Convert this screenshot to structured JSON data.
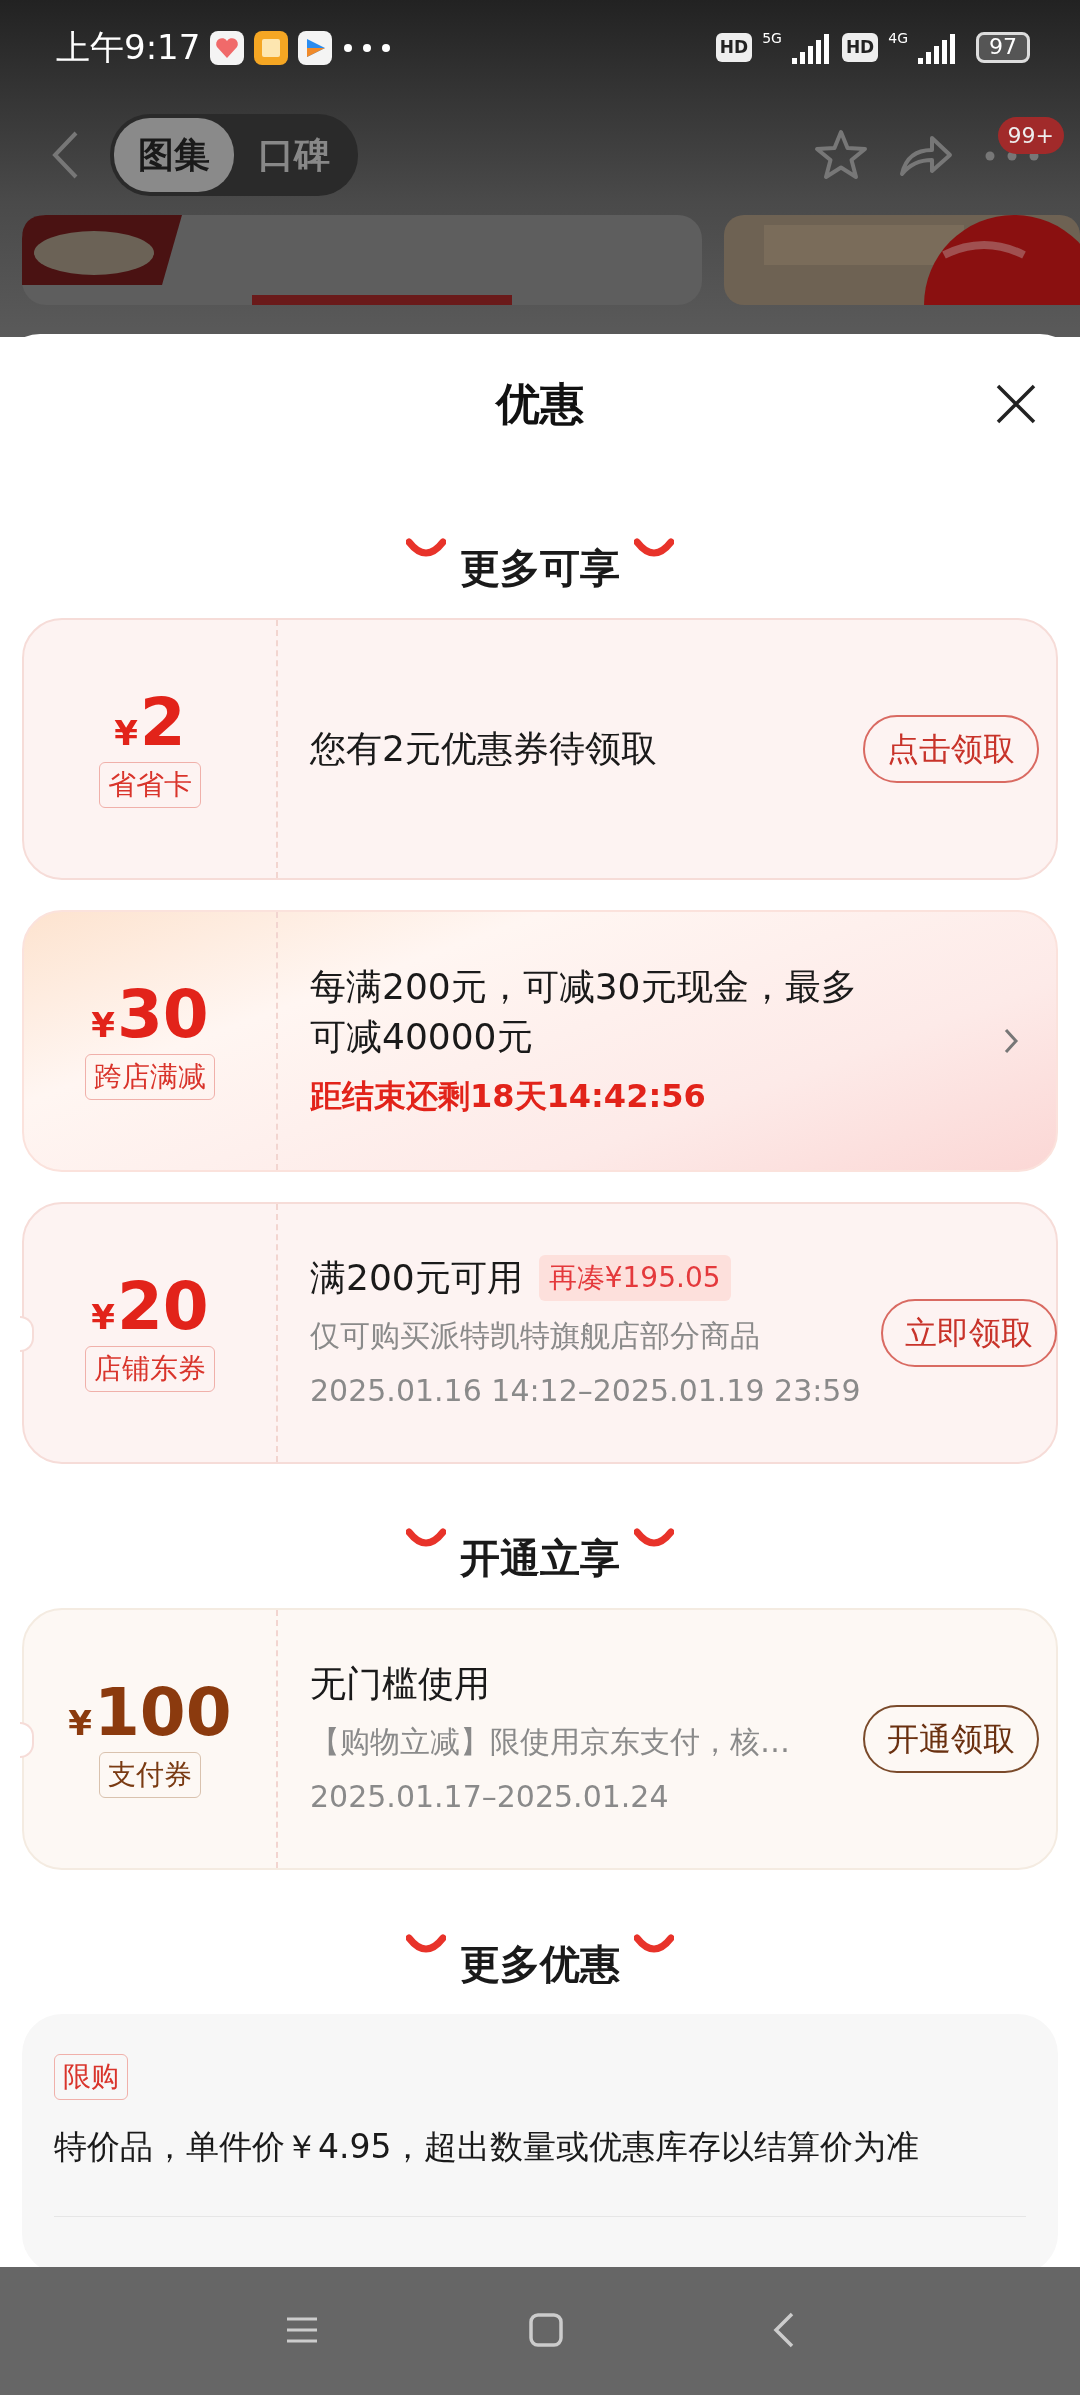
{
  "status_bar": {
    "time": "上午9:17",
    "hd_1": "HD",
    "network_1": "5G",
    "hd_2": "HD",
    "network_2": "4G",
    "battery": "97"
  },
  "header": {
    "tabs": [
      {
        "label": "图集",
        "selected": true
      },
      {
        "label": "口碑",
        "selected": false
      }
    ],
    "badge": "99+"
  },
  "sheet": {
    "title": "优惠"
  },
  "sections": [
    {
      "heading": "更多可享",
      "coupons": [
        {
          "kind": "red",
          "currency": "¥",
          "amount": "2",
          "tag": "省省卡",
          "title": "您有2元优惠券待领取",
          "button": "点击领取"
        },
        {
          "kind": "festive",
          "currency": "¥",
          "amount": "30",
          "tag": "跨店满减",
          "title": "每满200元，可减30元现金，最多可减40000元",
          "countdown": "距结束还剩18天14:42:56"
        },
        {
          "kind": "red",
          "currency": "¥",
          "amount": "20",
          "tag": "店铺东券",
          "title": "满200元可用",
          "badge": "再凑¥195.05",
          "desc": "仅可购买派特凯特旗舰店部分商品",
          "date": "2025.01.16 14:12–2025.01.19 23:59",
          "button": "立即领取"
        }
      ]
    },
    {
      "heading": "开通立享",
      "coupons": [
        {
          "kind": "brown",
          "currency": "¥",
          "amount": "100",
          "tag": "支付券",
          "title": "无门槛使用",
          "desc": "【购物立减】限使用京东支付，核…",
          "date": "2025.01.17–2025.01.24",
          "button": "开通领取"
        }
      ]
    },
    {
      "heading": "更多优惠",
      "offers": [
        {
          "tag": "限购",
          "text": "特价品，单件价￥4.95，超出数量或优惠库存以结算价为准"
        }
      ]
    }
  ]
}
